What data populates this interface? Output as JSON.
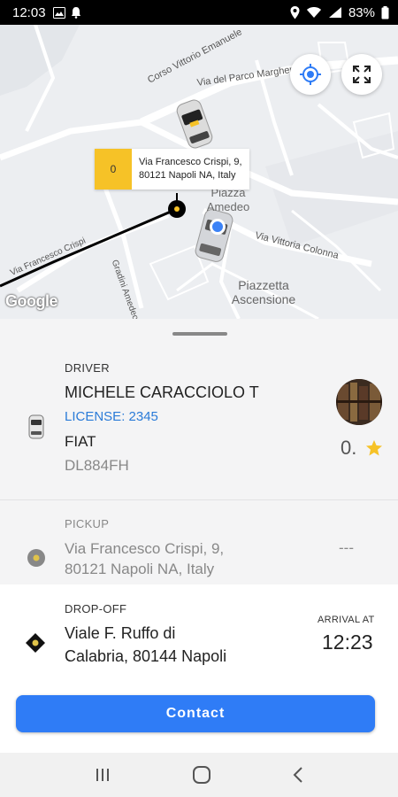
{
  "status_bar": {
    "time": "12:03",
    "battery": "83%"
  },
  "map": {
    "roads": [
      "Corso Vittorio Emanuele",
      "Via del Parco Margherita",
      "Via Vittoria Colonna",
      "Via Francesco Crispi",
      "Gradini Amedeo"
    ],
    "places": [
      "Piazza Amedeo",
      "Piazzetta Ascensione"
    ],
    "callout": {
      "eta": "0",
      "address_line1": "Via Francesco Crispi, 9,",
      "address_line2": "80121 Napoli NA, Italy"
    },
    "attribution": "Google"
  },
  "driver": {
    "section_label": "DRIVER",
    "name": "MICHELE  CARACCIOLO T",
    "license": "LICENSE: 2345",
    "car_make": "FIAT",
    "plate": "DL884FH",
    "rating": "0.",
    "rating_color": "#f6c227"
  },
  "pickup": {
    "section_label": "PICKUP",
    "address_line1": "Via Francesco Crispi, 9,",
    "address_line2": "80121 Napoli NA, Italy",
    "time": "---"
  },
  "dropoff": {
    "section_label": "DROP-OFF",
    "address_line1": "Viale F. Ruffo di",
    "address_line2": "Calabria, 80144 Napoli",
    "arrival_label": "ARRIVAL AT",
    "arrival_time": "12:23"
  },
  "actions": {
    "contact_label": "Contact",
    "accent_color": "#2f7cf6"
  }
}
